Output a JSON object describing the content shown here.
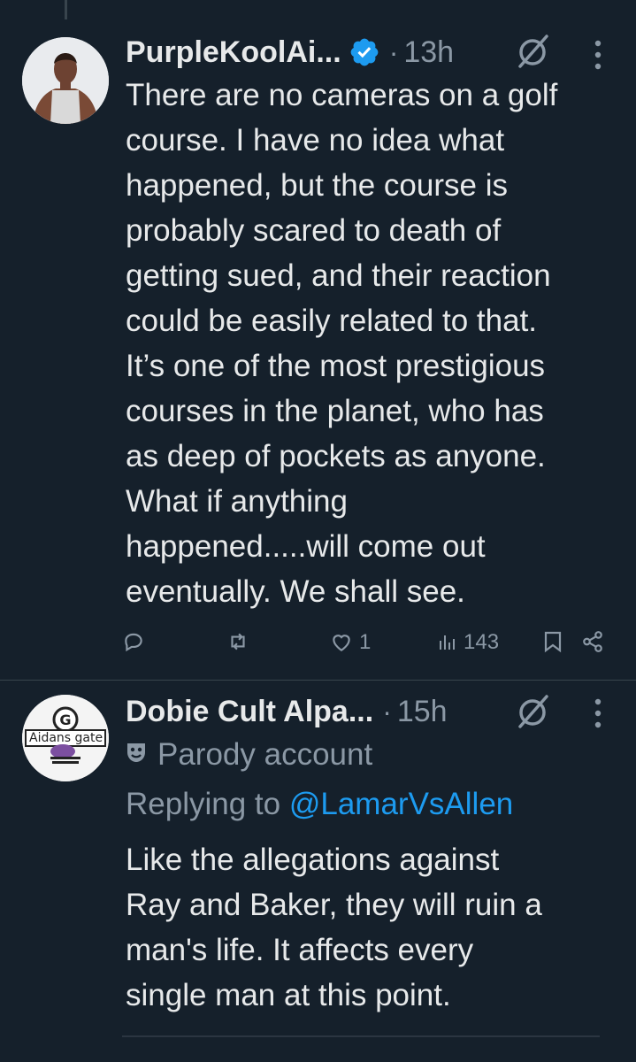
{
  "tweets": [
    {
      "display_name": "PurpleKoolAi...",
      "verified": true,
      "time": "13h",
      "text": "There are no cameras on a golf\ncourse. I have no idea what\nhappened, but the course is\nprobably scared to death of\ngetting sued, and their reaction\ncould be easily related to that.\nIt’s one of the most prestigious\ncourses in the planet, who has\nas deep of pockets as anyone.\nWhat if anything\nhappened.....will come out\neventually. We shall see.",
      "likes": "1",
      "views": "143"
    },
    {
      "display_name": "Dobie Cult Alpa...",
      "time": "15h",
      "badge": "Parody account",
      "reply_prefix": "Replying to",
      "reply_handle": "@LamarVsAllen",
      "avatar_text": "Aidans gate",
      "text": "Like the allegations against\nRay and Baker, they will ruin a\nman's life. It affects every\nsingle man at this point."
    }
  ],
  "icons": {
    "verified": "verified-badge-icon",
    "grok": "grok-icon",
    "more": "more-icon",
    "reply": "reply-icon",
    "repost": "repost-icon",
    "like": "like-icon",
    "views": "views-icon",
    "bookmark": "bookmark-icon",
    "share": "share-icon",
    "parody": "parody-mask-icon"
  },
  "colors": {
    "background": "#15202b",
    "text": "#e7e9ea",
    "muted": "#8b98a5",
    "accent": "#1d9bf0",
    "divider": "#38444d"
  }
}
